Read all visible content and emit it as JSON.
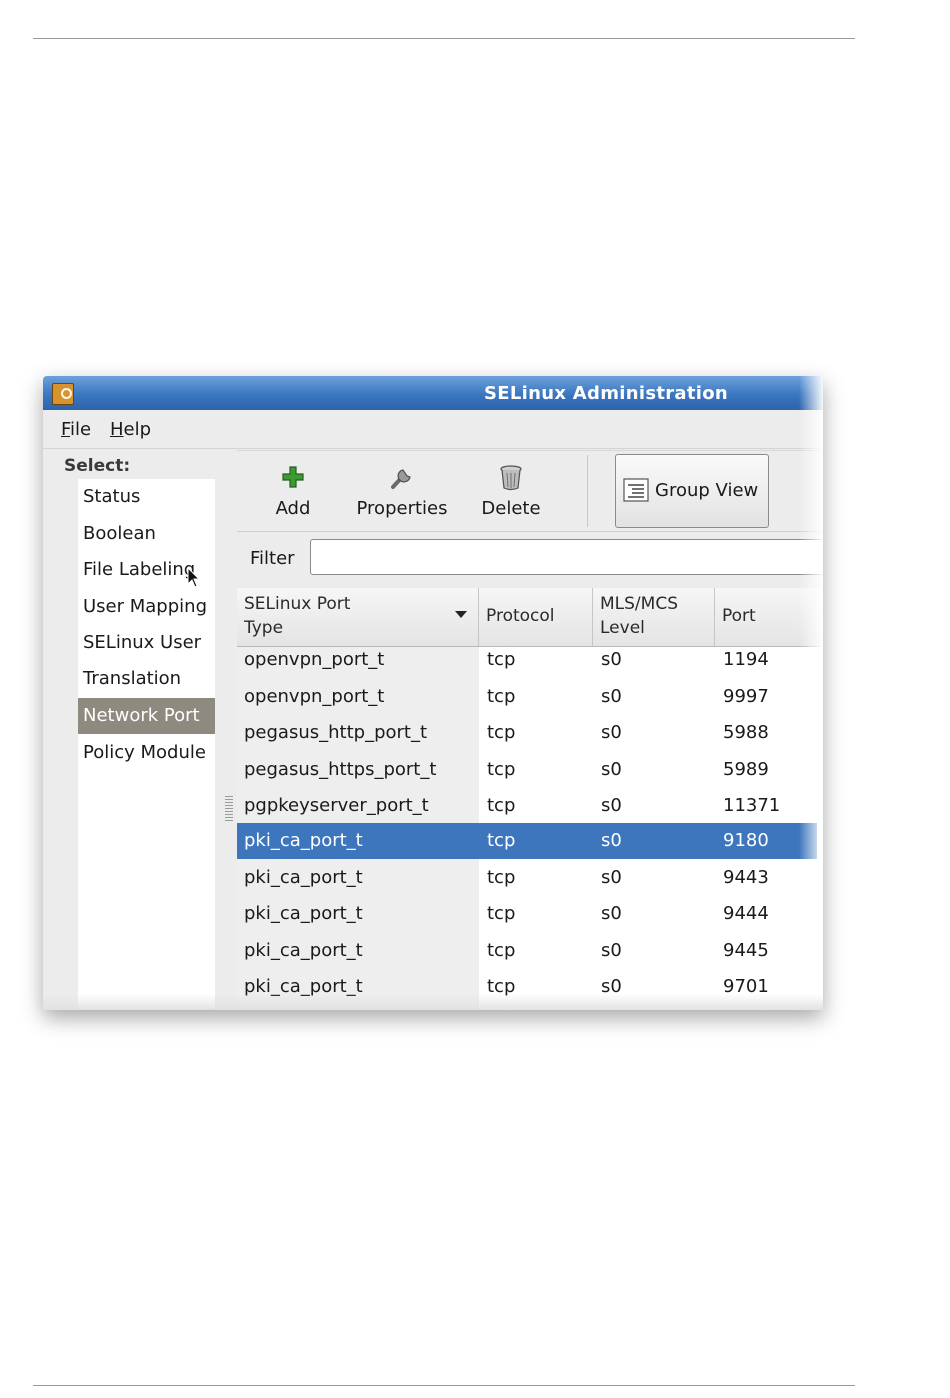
{
  "window": {
    "title": "SELinux Administration",
    "icon": "selinux-app-icon"
  },
  "menu": {
    "file": {
      "mnemonic": "F",
      "rest": "ile"
    },
    "help": {
      "mnemonic": "H",
      "rest": "elp"
    }
  },
  "sidebar": {
    "heading": "Select:",
    "items": [
      {
        "label": "Status"
      },
      {
        "label": "Boolean"
      },
      {
        "label": "File Labeling"
      },
      {
        "label": "User Mapping"
      },
      {
        "label": "SELinux User"
      },
      {
        "label": "Translation"
      },
      {
        "label": "Network Port",
        "selected": true
      },
      {
        "label": "Policy Module"
      }
    ]
  },
  "toolbar": {
    "add_label": "Add",
    "add_icon": "plus-icon",
    "properties_label": "Properties",
    "properties_icon": "wrench-icon",
    "delete_label": "Delete",
    "delete_icon": "trash-icon",
    "group_view_label": "Group View",
    "group_view_icon": "list-view-icon"
  },
  "filter": {
    "label": "Filter",
    "value": ""
  },
  "table": {
    "columns": [
      "SELinux Port Type",
      "Protocol",
      "MLS/MCS Level",
      "Port"
    ],
    "column_lines": {
      "type": [
        "SELinux Port",
        "Type"
      ],
      "level": [
        "MLS/MCS",
        "Level"
      ]
    },
    "sort_column": "SELinux Port Type",
    "rows": [
      {
        "type": "openvpn_port_t",
        "protocol": "tcp",
        "level": "s0",
        "port": "1194"
      },
      {
        "type": "openvpn_port_t",
        "protocol": "tcp",
        "level": "s0",
        "port": "9997"
      },
      {
        "type": "pegasus_http_port_t",
        "protocol": "tcp",
        "level": "s0",
        "port": "5988"
      },
      {
        "type": "pegasus_https_port_t",
        "protocol": "tcp",
        "level": "s0",
        "port": "5989"
      },
      {
        "type": "pgpkeyserver_port_t",
        "protocol": "tcp",
        "level": "s0",
        "port": "11371"
      },
      {
        "type": "pki_ca_port_t",
        "protocol": "tcp",
        "level": "s0",
        "port": "9180",
        "selected": true
      },
      {
        "type": "pki_ca_port_t",
        "protocol": "tcp",
        "level": "s0",
        "port": "9443"
      },
      {
        "type": "pki_ca_port_t",
        "protocol": "tcp",
        "level": "s0",
        "port": "9444"
      },
      {
        "type": "pki_ca_port_t",
        "protocol": "tcp",
        "level": "s0",
        "port": "9445"
      },
      {
        "type": "pki_ca_port_t",
        "protocol": "tcp",
        "level": "s0",
        "port": "9701"
      }
    ]
  },
  "colors": {
    "titlebar": "#3b76c0",
    "selection": "#3d76bd",
    "sidebar_selection": "#8e8a80"
  }
}
